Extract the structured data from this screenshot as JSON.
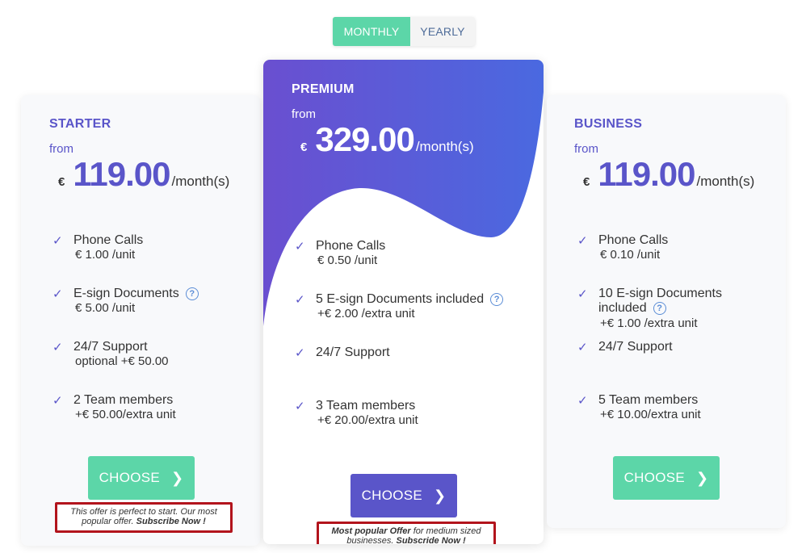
{
  "toggle": {
    "monthly": "MONTHLY",
    "yearly": "YEARLY"
  },
  "colors": {
    "accent": "#5a55c9",
    "green": "#5cd6a8",
    "gradient_start": "#6a4fd0",
    "gradient_end": "#4a69e0",
    "note_border": "#b2141c"
  },
  "starter": {
    "name": "STARTER",
    "from": "from",
    "currency": "€",
    "price": "119.00",
    "per": "/month(s)",
    "features": [
      {
        "title": "Phone Calls",
        "sub": "€ 1.00 /unit"
      },
      {
        "title": "E-sign Documents",
        "sub": "€ 5.00 /unit",
        "help": "?"
      },
      {
        "title": "24/7 Support",
        "sub": "optional +€ 50.00"
      },
      {
        "title": "2 Team members",
        "sub": "+€ 50.00/extra unit"
      }
    ],
    "button": "CHOOSE",
    "note_text": "This offer is perfect to start. Our most popular offer.",
    "note_cta": "Subscribe Now !"
  },
  "premium": {
    "name": "PREMIUM",
    "from": "from",
    "currency": "€",
    "price": "329.00",
    "per": "/month(s)",
    "features": [
      {
        "title": "Phone Calls",
        "sub": "€ 0.50 /unit"
      },
      {
        "title": "5 E-sign Documents included",
        "sub": "+€ 2.00 /extra unit",
        "help": "?"
      },
      {
        "title": "24/7 Support",
        "sub": ""
      },
      {
        "title": "3 Team members",
        "sub": "+€ 20.00/extra unit"
      }
    ],
    "button": "CHOOSE",
    "note_bold": "Most popular Offer",
    "note_text": "for medium sized businesses.",
    "note_cta": "Subscride Now !"
  },
  "business": {
    "name": "BUSINESS",
    "from": "from",
    "currency": "€",
    "price": "119.00",
    "per": "/month(s)",
    "features": [
      {
        "title": "Phone Calls",
        "sub": "€ 0.10 /unit"
      },
      {
        "title": "10 E-sign Documents",
        "title2": "included",
        "sub": "+€ 1.00 /extra unit",
        "help": "?"
      },
      {
        "title": "24/7 Support",
        "sub": ""
      },
      {
        "title": "5 Team members",
        "sub": "+€ 10.00/extra unit"
      }
    ],
    "button": "CHOOSE"
  },
  "icons": {
    "check": "✓",
    "chevron": "❯"
  }
}
